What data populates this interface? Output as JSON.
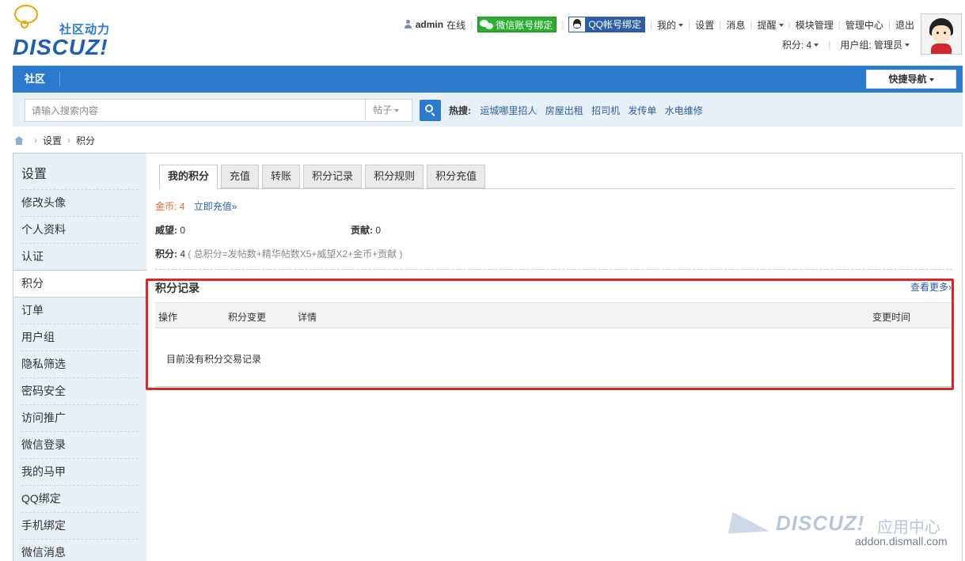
{
  "logo": {
    "tagline": "社区动力",
    "name": "DISCUZ!"
  },
  "topbar": {
    "username": "admin",
    "online": "在线",
    "wechat_bind": "微信账号绑定",
    "qq_bind": "QQ帐号绑定",
    "my": "我的",
    "settings": "设置",
    "messages": "消息",
    "reminders": "提醒",
    "modules": "模块管理",
    "admin_center": "管理中心",
    "logout": "退出",
    "credits": "积分: 4",
    "usergroup": "用户组: 管理员"
  },
  "nav": {
    "community": "社区",
    "quick_nav": "快捷导航"
  },
  "search": {
    "placeholder": "请输入搜索内容",
    "type": "帖子",
    "hot_label": "热搜:",
    "hot_links": [
      "运城哪里招人",
      "房屋出租",
      "招司机",
      "发传单",
      "水电维修"
    ]
  },
  "breadcrumb": {
    "settings": "设置",
    "credits": "积分"
  },
  "sidebar": {
    "title": "设置",
    "items": [
      "修改头像",
      "个人资料",
      "认证",
      "积分",
      "订单",
      "用户组",
      "隐私筛选",
      "密码安全",
      "访问推广",
      "微信登录",
      "我的马甲",
      "QQ绑定",
      "手机绑定",
      "微信消息"
    ],
    "active_index": 3
  },
  "tabs": [
    "我的积分",
    "充值",
    "转账",
    "积分记录",
    "积分规则",
    "积分充值"
  ],
  "credits": {
    "gold_label": "金币:",
    "gold_value": "4",
    "recharge_link": "立即充值»",
    "prestige_label": "威望:",
    "prestige_value": "0",
    "contribution_label": "贡献:",
    "contribution_value": "0",
    "total_label": "积分:",
    "total_value": "4",
    "formula": "( 总积分=发帖数+精华帖数X5+威望X2+金币+贡献 )"
  },
  "records": {
    "title": "积分记录",
    "more": "查看更多»",
    "columns": [
      "操作",
      "积分变更",
      "详情",
      "变更时间"
    ],
    "empty": "目前没有积分交易记录"
  },
  "watermark": {
    "logo": "DISCUZ!",
    "center": "应用中心",
    "url": "addon.dismall.com"
  },
  "colors": {
    "brand_blue": "#2b7acd",
    "highlight_red": "#e02424",
    "gold_orange": "#e06826"
  }
}
